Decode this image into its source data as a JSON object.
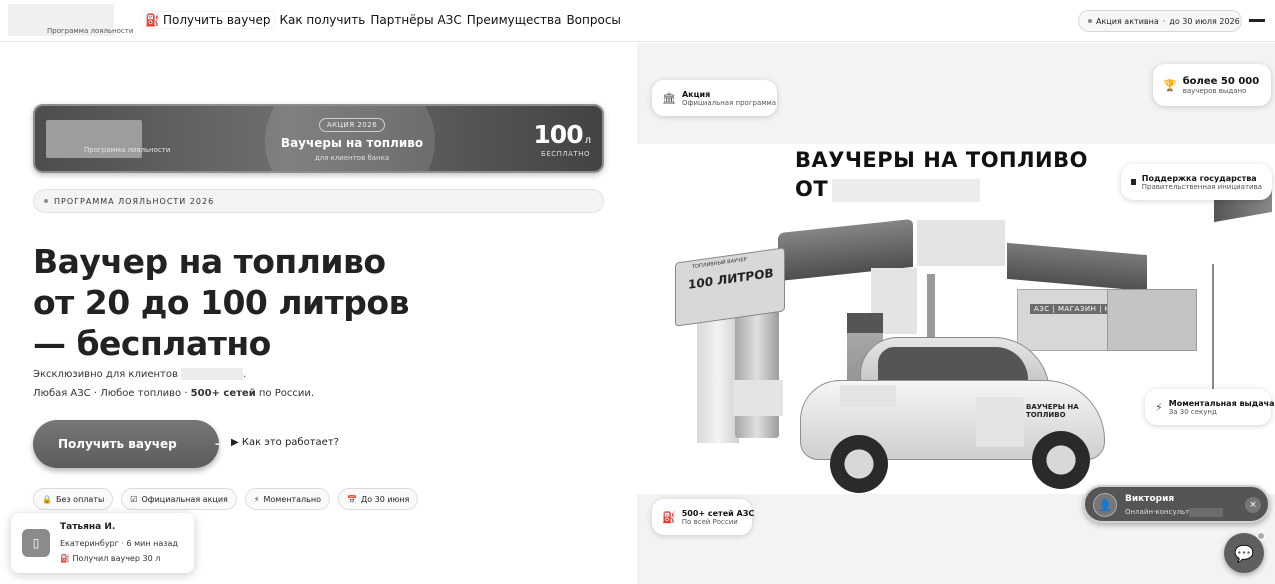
{
  "header": {
    "logo_caption": "Программа лояльности",
    "nav": [
      {
        "label": "Получить ваучер",
        "icon": "fuel-pump-icon"
      },
      {
        "label": "Как получить"
      },
      {
        "label": "Партнёры АЗС"
      },
      {
        "label": "Преимущества"
      },
      {
        "label": "Вопросы"
      }
    ],
    "status": {
      "text": "Акция активна",
      "sep": "·",
      "until": "до 30 июля 2026"
    }
  },
  "banner": {
    "logo_caption": "Программа лояльности",
    "tag": "АКЦИЯ 2026",
    "title": "Ваучеры на топливо",
    "subtitle": "для клиентов банка",
    "amount": "100",
    "unit": "л",
    "free": "БЕСПЛАТНО"
  },
  "program_label": "ПРОГРАММА ЛОЯЛЬНОСТИ 2026",
  "headline": [
    "Ваучер на топливо",
    "от 20 до 100 литров",
    "— бесплатно"
  ],
  "description": {
    "line1": "Эксклюзивно для клиентов",
    "line1_end": ".",
    "line2_a": "Любая АЗС · Любое топливо · ",
    "line2_b": "500+ сетей",
    "line2_c": " по России."
  },
  "cta": {
    "label": "Получить ваучер",
    "arrow": "→"
  },
  "how": {
    "marker": "▶",
    "label": "Как это работает?"
  },
  "chips": [
    {
      "icon": "lock-icon",
      "glyph": "🔒",
      "label": "Без оплаты"
    },
    {
      "icon": "check-icon",
      "glyph": "☑",
      "label": "Официальная акция"
    },
    {
      "icon": "lightning-icon",
      "glyph": "⚡",
      "label": "Моментально"
    },
    {
      "icon": "calendar-icon",
      "glyph": "📅",
      "label": "До 30 июня"
    }
  ],
  "toast": {
    "name": "Татьяна И.",
    "meta": "Екатеринбург · 6 мин назад",
    "got": "Получил ваучер 30 л"
  },
  "right": {
    "card_action": {
      "title": "Акция",
      "subtitle": "Официальная программа"
    },
    "card_vouchers": {
      "title": "более 50 000",
      "subtitle": "ваучеров выдано"
    },
    "card_gov": {
      "title": "Поддержка государства",
      "subtitle": "Правительственная инициатива"
    },
    "card_instant": {
      "title": "Моментальная выдача",
      "subtitle": "За 30 секунд"
    },
    "card_stations": {
      "title": "500+ сетей АЗС",
      "subtitle": "По всей России"
    },
    "hero_title_1": "ВАУЧЕРЫ НА ТОПЛИВО",
    "hero_title_2": "ОТ",
    "sign_big": "100 ЛИТРОВ",
    "sign_small": "ТОПЛИВНЫЙ ВАУЧЕР",
    "shop_label": "АЗС   |   МАГАЗИН   |   КАФЕ",
    "car_text": "ВАУЧЕРЫ НА ТОПЛИВО"
  },
  "chat": {
    "name": "Виктория",
    "role": "Онлайн-консультант",
    "close": "×"
  }
}
